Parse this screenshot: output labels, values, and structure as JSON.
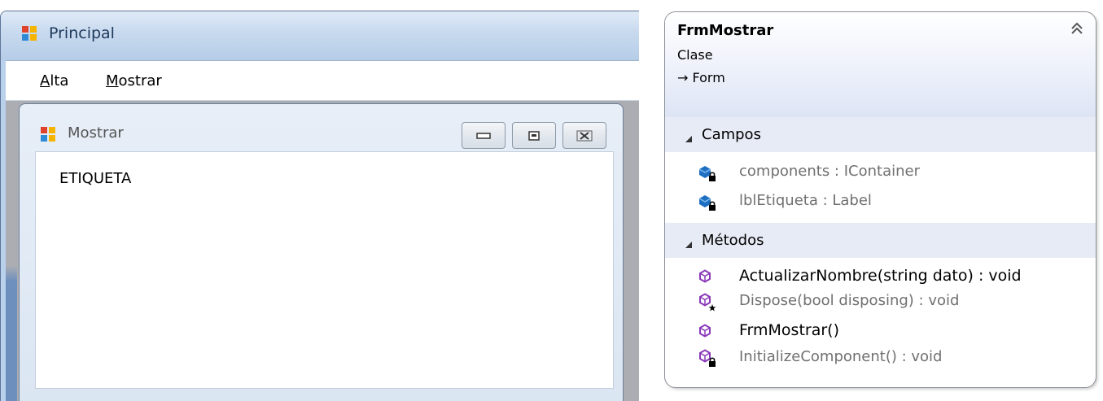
{
  "principal": {
    "title": "Principal",
    "menu": [
      {
        "accel": "A",
        "rest": "lta"
      },
      {
        "accel": "M",
        "rest": "ostrar"
      }
    ]
  },
  "mostrar": {
    "title": "Mostrar",
    "label_text": "ETIQUETA"
  },
  "class_diagram": {
    "name": "FrmMostrar",
    "kind": "Clase",
    "base": "→ Form",
    "sections": [
      {
        "title": "Campos",
        "members": [
          {
            "text": "components : IContainer",
            "icon": "private-field-icon"
          },
          {
            "text": "lblEtiqueta : Label",
            "icon": "private-field-icon"
          }
        ]
      },
      {
        "title": "Métodos",
        "members": [
          {
            "text": "ActualizarNombre(string dato) : void",
            "icon": "public-method-icon"
          },
          {
            "text": "Dispose(bool disposing) : void",
            "icon": "protected-method-icon"
          },
          {
            "text": "FrmMostrar()",
            "icon": "public-method-icon"
          },
          {
            "text": "InitializeComponent() : void",
            "icon": "private-method-icon"
          }
        ]
      }
    ]
  },
  "colors": {
    "titlebar": "#c7d9ee",
    "class_header": "#dde4f4",
    "method_icon": "#8a3ab9",
    "field_icon": "#1e6fc2"
  }
}
